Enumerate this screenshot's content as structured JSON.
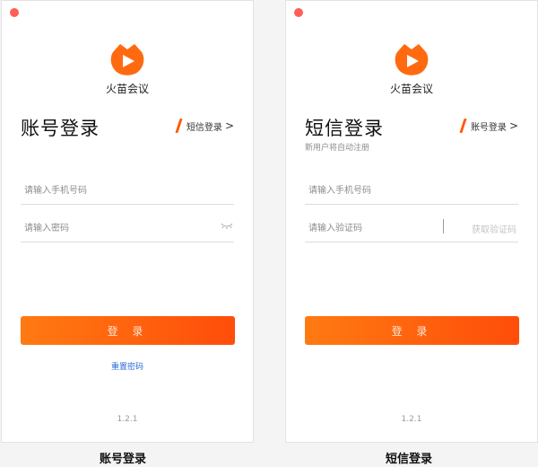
{
  "app": {
    "name": "火苗会议",
    "version": "1.2.1",
    "accent_color": "#ff5a00",
    "logo_icon": "flame-play-icon"
  },
  "account_login": {
    "title": "账号登录",
    "switch_label": "短信登录",
    "switch_chevron": ">",
    "phone_placeholder": "请输入手机号码",
    "password_placeholder": "请输入密码",
    "password_icon": "eye-closed-icon",
    "submit_label": "登 录",
    "reset_link": "重置密码",
    "caption": "账号登录"
  },
  "sms_login": {
    "title": "短信登录",
    "subtitle": "新用户将自动注册",
    "switch_label": "账号登录",
    "switch_chevron": ">",
    "phone_placeholder": "请输入手机号码",
    "code_placeholder": "请输入验证码",
    "get_code_label": "获取验证码",
    "submit_label": "登 录",
    "caption": "短信登录"
  }
}
